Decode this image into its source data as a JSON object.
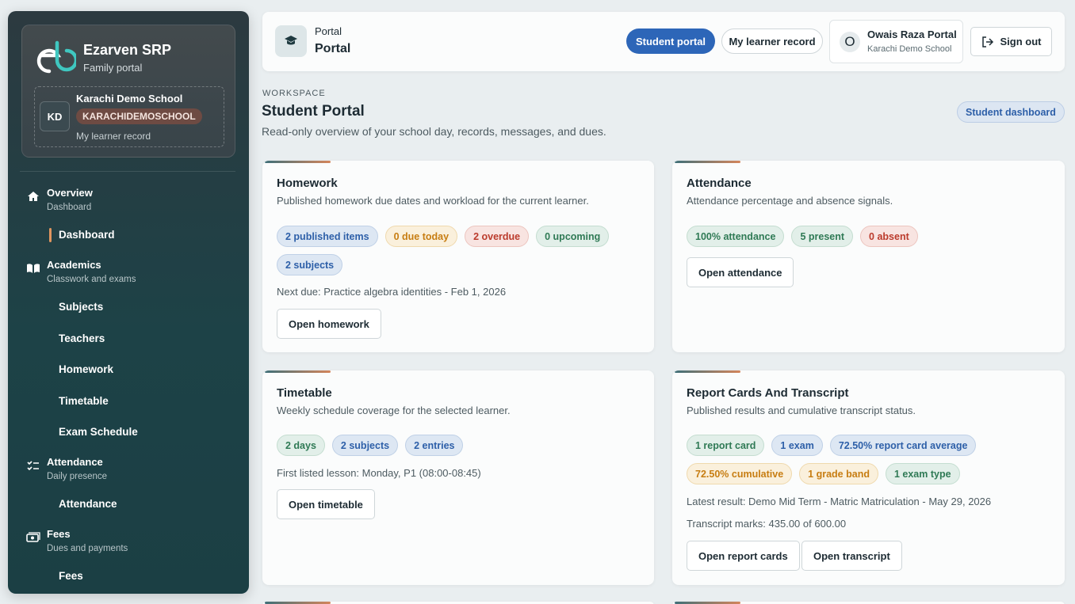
{
  "sidebar": {
    "brand_title": "Ezarven SRP",
    "brand_subtitle": "Family portal",
    "school": {
      "initials": "KD",
      "name": "Karachi Demo School",
      "code": "KARACHIDEMOSCHOOL",
      "role": "My learner record"
    },
    "groups": [
      {
        "title": "Overview",
        "subtitle": "Dashboard",
        "icon": "home-icon",
        "items": [
          "Dashboard"
        ]
      },
      {
        "title": "Academics",
        "subtitle": "Classwork and exams",
        "icon": "book-icon",
        "items": [
          "Subjects",
          "Teachers",
          "Homework",
          "Timetable",
          "Exam Schedule"
        ]
      },
      {
        "title": "Attendance",
        "subtitle": "Daily presence",
        "icon": "checklist-icon",
        "items": [
          "Attendance"
        ]
      },
      {
        "title": "Fees",
        "subtitle": "Dues and payments",
        "icon": "money-icon",
        "items": [
          "Fees"
        ]
      }
    ]
  },
  "topbar": {
    "small": "Portal",
    "big": "Portal",
    "student_portal": "Student portal",
    "learner_record": "My learner record",
    "user_initial": "O",
    "user_name": "Owais Raza Portal",
    "user_school": "Karachi Demo School",
    "sign_out": "Sign out"
  },
  "workspace": {
    "label": "WORKSPACE",
    "title": "Student Portal",
    "description": "Read-only overview of your school day, records, messages, and dues.",
    "tag": "Student dashboard"
  },
  "cards": {
    "homework": {
      "title": "Homework",
      "description": "Published homework due dates and workload for the current learner.",
      "chips": [
        "2 published items",
        "0 due today",
        "2 overdue",
        "0 upcoming",
        "2 subjects"
      ],
      "note": "Next due: Practice algebra identities - Feb 1, 2026",
      "button": "Open homework"
    },
    "attendance": {
      "title": "Attendance",
      "description": "Attendance percentage and absence signals.",
      "chips": [
        "100% attendance",
        "5 present",
        "0 absent"
      ],
      "button": "Open attendance"
    },
    "timetable": {
      "title": "Timetable",
      "description": "Weekly schedule coverage for the selected learner.",
      "chips": [
        "2 days",
        "2 subjects",
        "2 entries"
      ],
      "note": "First listed lesson: Monday, P1 (08:00-08:45)",
      "button": "Open timetable"
    },
    "reports": {
      "title": "Report Cards And Transcript",
      "description": "Published results and cumulative transcript status.",
      "chips": [
        "1 report card",
        "1 exam",
        "72.50% report card average",
        "72.50% cumulative",
        "1 grade band",
        "1 exam type"
      ],
      "note1": "Latest result: Demo Mid Term - Matric Matriculation - May 29, 2026",
      "note2": "Transcript marks: 435.00 of 600.00",
      "button1": "Open report cards",
      "button2": "Open transcript"
    }
  },
  "colors": {
    "primary": "#2d66b8",
    "sidebar": "#1d4247",
    "accent": "#e0955f"
  }
}
